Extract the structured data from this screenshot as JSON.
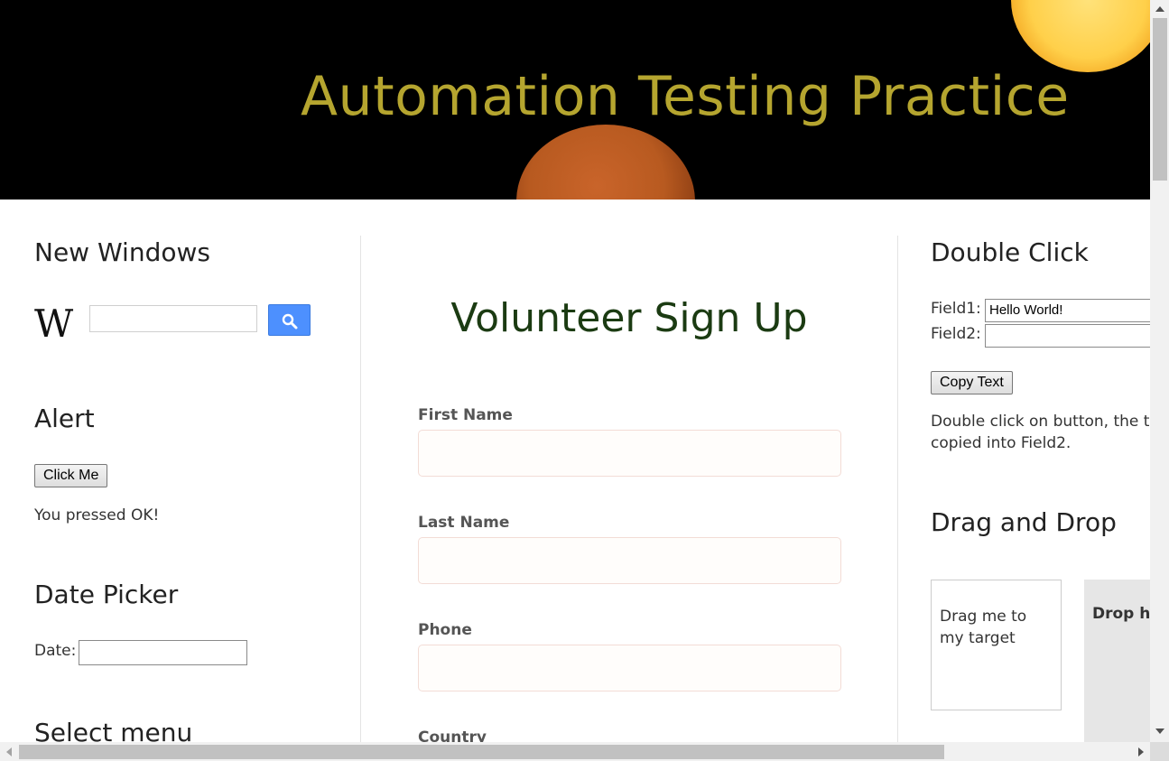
{
  "header": {
    "title": "Automation Testing Practice"
  },
  "left": {
    "new_windows": {
      "heading": "New Windows",
      "logo_text": "W",
      "search_value": ""
    },
    "alert": {
      "heading": "Alert",
      "button_label": "Click Me",
      "result_text": "You pressed OK!"
    },
    "date_picker": {
      "heading": "Date Picker",
      "label": "Date:",
      "value": ""
    },
    "select_menu": {
      "heading": "Select menu"
    }
  },
  "form": {
    "title": "Volunteer Sign Up",
    "fields": [
      {
        "label": "First Name",
        "value": ""
      },
      {
        "label": "Last Name",
        "value": ""
      },
      {
        "label": "Phone",
        "value": ""
      },
      {
        "label": "Country"
      }
    ]
  },
  "right": {
    "double_click": {
      "heading": "Double Click",
      "field1_label": "Field1:",
      "field1_value": "Hello World!",
      "field2_label": "Field2:",
      "field2_value": "",
      "button_label": "Copy Text",
      "description": "Double click on button, the te",
      "description_line2": "copied into Field2."
    },
    "drag_drop": {
      "heading": "Drag and Drop",
      "draggable_text": "Drag me to my target",
      "drop_text": "Drop he"
    }
  },
  "colors": {
    "header_title": "#b5a52f",
    "form_title": "#1b3b12",
    "search_button": "#4d90fe"
  },
  "icons": {
    "search_button": "search-icon"
  }
}
